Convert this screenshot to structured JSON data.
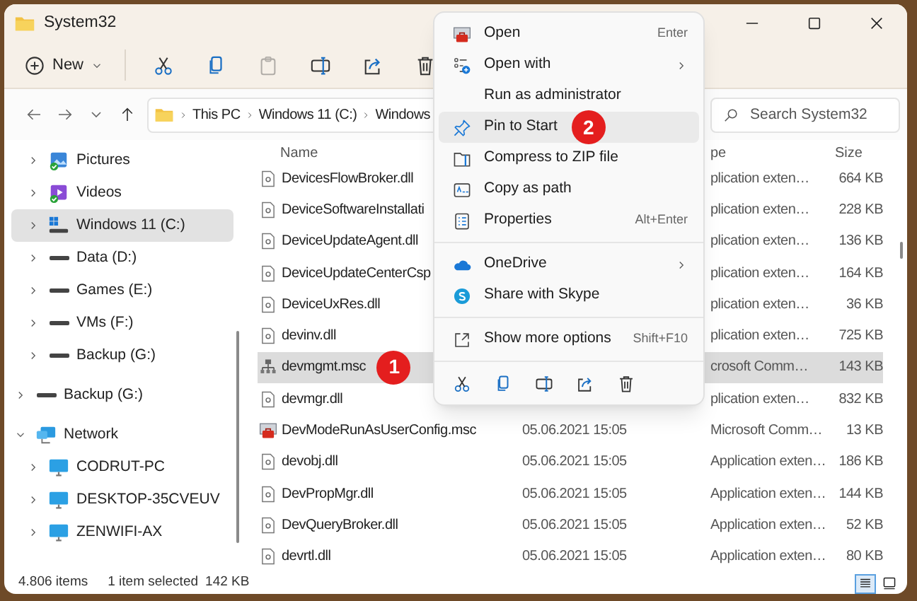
{
  "window": {
    "title": "System32"
  },
  "toolbar": {
    "new_label": "New",
    "buttons": [
      {
        "disabled": false
      },
      {
        "disabled": false
      },
      {
        "disabled": true
      },
      {
        "disabled": false
      },
      {
        "disabled": false
      },
      {
        "disabled": false
      }
    ]
  },
  "address": {
    "breadcrumb": [
      "This PC",
      "Windows 11 (C:)",
      "Windows"
    ],
    "search_placeholder": "Search System32"
  },
  "nav": {
    "continued_children": [
      {
        "label": "Pictures",
        "kind": "pictures",
        "expanded": false,
        "selected": false
      },
      {
        "label": "Videos",
        "kind": "videos",
        "expanded": false,
        "selected": false
      },
      {
        "label": "Windows 11 (C:)",
        "kind": "system-drive",
        "expanded": false,
        "selected": true
      },
      {
        "label": "Data (D:)",
        "kind": "drive",
        "expanded": false,
        "selected": false
      },
      {
        "label": "Games (E:)",
        "kind": "drive",
        "expanded": false,
        "selected": false
      },
      {
        "label": "VMs (F:)",
        "kind": "drive",
        "expanded": false,
        "selected": false
      },
      {
        "label": "Backup (G:)",
        "kind": "drive",
        "expanded": false,
        "selected": false
      }
    ],
    "tree": [
      {
        "label": "Backup (G:)",
        "kind": "drive",
        "expanded": false,
        "selected": false
      },
      {
        "label": "Network",
        "kind": "network",
        "expanded": true,
        "selected": false,
        "children": [
          {
            "label": "CODRUT-PC",
            "kind": "computer",
            "expanded": false,
            "selected": false
          },
          {
            "label": "DESKTOP-35CVEUV",
            "kind": "computer",
            "expanded": false,
            "selected": false
          },
          {
            "label": "ZENWIFI-AX",
            "kind": "computer",
            "expanded": false,
            "selected": false
          }
        ]
      }
    ]
  },
  "table": {
    "columns": [
      "Name",
      "pe",
      "Size"
    ],
    "rows": [
      {
        "name": "DevicesFlowBroker.dll",
        "kind": "dll",
        "type": "plication exten…",
        "size": "664 KB",
        "selected": false
      },
      {
        "name": "DeviceSoftwareInstallati",
        "kind": "dll",
        "type": "plication exten…",
        "size": "228 KB",
        "selected": false
      },
      {
        "name": "DeviceUpdateAgent.dll",
        "kind": "dll",
        "type": "plication exten…",
        "size": "136 KB",
        "selected": false
      },
      {
        "name": "DeviceUpdateCenterCsp",
        "kind": "dll",
        "type": "plication exten…",
        "size": "164 KB",
        "selected": false
      },
      {
        "name": "DeviceUxRes.dll",
        "kind": "dll",
        "type": "plication exten…",
        "size": "36 KB",
        "selected": false
      },
      {
        "name": "devinv.dll",
        "kind": "dll",
        "type": "plication exten…",
        "size": "725 KB",
        "selected": false
      },
      {
        "name": "devmgmt.msc",
        "kind": "device-console",
        "type": "crosoft Comm…",
        "size": "143 KB",
        "selected": true,
        "callout": "1"
      },
      {
        "name": "devmgr.dll",
        "kind": "dll",
        "type": "plication exten…",
        "size": "832 KB",
        "selected": false
      },
      {
        "name": "DevModeRunAsUserConfig.msc",
        "kind": "console",
        "date": "05.06.2021 15:05",
        "type": "Microsoft Comm…",
        "size": "13 KB",
        "selected": false
      },
      {
        "name": "devobj.dll",
        "kind": "dll",
        "date": "05.06.2021 15:05",
        "type": "Application exten…",
        "size": "186 KB",
        "selected": false
      },
      {
        "name": "DevPropMgr.dll",
        "kind": "dll",
        "date": "05.06.2021 15:05",
        "type": "Application exten…",
        "size": "144 KB",
        "selected": false
      },
      {
        "name": "DevQueryBroker.dll",
        "kind": "dll",
        "date": "05.06.2021 15:05",
        "type": "Application exten…",
        "size": "52 KB",
        "selected": false
      },
      {
        "name": "devrtl.dll",
        "kind": "dll",
        "date": "05.06.2021 15:05",
        "type": "Application exten…",
        "size": "80 KB",
        "selected": false
      }
    ]
  },
  "status_bar": {
    "items_count": "4.806 items",
    "selection": "1 item selected",
    "selection_size": "142 KB",
    "views": [
      {
        "selected": true
      },
      {
        "selected": false
      }
    ]
  },
  "context_menu": {
    "items": [
      {
        "kind": "item",
        "label": "Open",
        "shortcut": "Enter",
        "submenu": false,
        "selected": false
      },
      {
        "kind": "item",
        "label": "Open with",
        "submenu": true,
        "selected": false
      },
      {
        "kind": "item",
        "label": "Run as administrator",
        "submenu": false,
        "selected": false
      },
      {
        "kind": "item",
        "label": "Pin to Start",
        "submenu": false,
        "selected": true,
        "callout": "2"
      },
      {
        "kind": "item",
        "label": "Compress to ZIP file",
        "submenu": false,
        "selected": false
      },
      {
        "kind": "item",
        "label": "Copy as path",
        "submenu": false,
        "selected": false
      },
      {
        "kind": "item",
        "label": "Properties",
        "shortcut": "Alt+Enter",
        "submenu": false,
        "selected": false
      },
      {
        "kind": "separator"
      },
      {
        "kind": "item",
        "label": "OneDrive",
        "submenu": true,
        "selected": false
      },
      {
        "kind": "item",
        "label": "Share with Skype",
        "submenu": false,
        "selected": false
      },
      {
        "kind": "separator"
      },
      {
        "kind": "item",
        "label": "Show more options",
        "shortcut": "Shift+F10",
        "submenu": false,
        "selected": false
      },
      {
        "kind": "separator"
      },
      {
        "kind": "icon-row"
      }
    ]
  }
}
